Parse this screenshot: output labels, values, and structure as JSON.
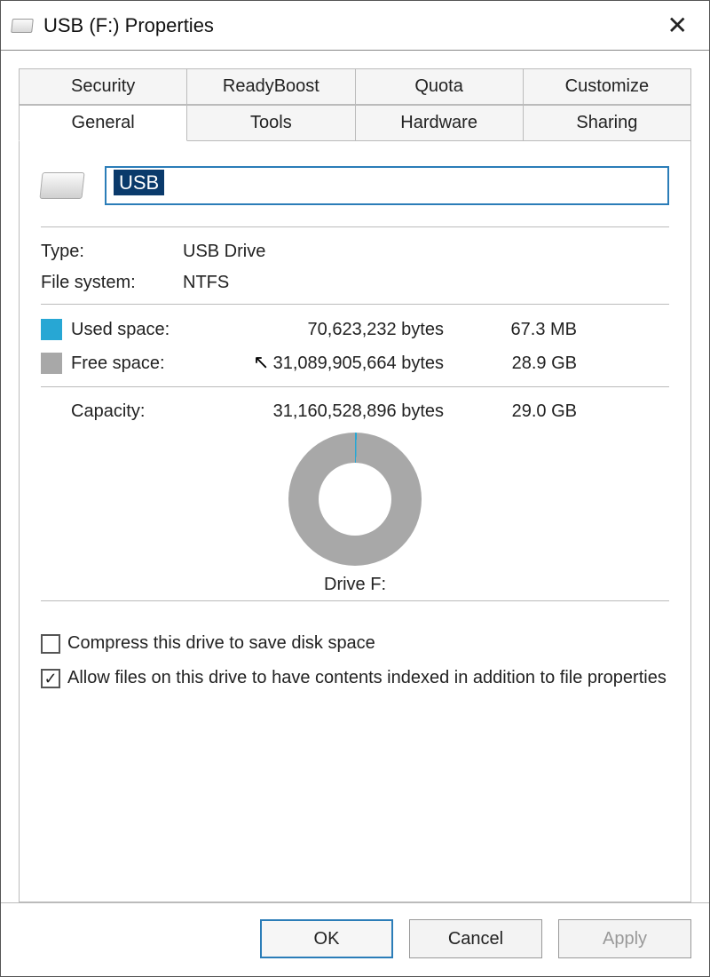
{
  "window": {
    "title": "USB (F:) Properties"
  },
  "tabs": {
    "row1": [
      "Security",
      "ReadyBoost",
      "Quota",
      "Customize"
    ],
    "row2": [
      "General",
      "Tools",
      "Hardware",
      "Sharing"
    ],
    "active": "General"
  },
  "drive": {
    "name": "USB",
    "type_label": "Type:",
    "type_value": "USB Drive",
    "fs_label": "File system:",
    "fs_value": "NTFS",
    "letter_label": "Drive F:"
  },
  "space": {
    "used_label": "Used space:",
    "used_bytes": "70,623,232 bytes",
    "used_human": "67.3 MB",
    "free_label": "Free space:",
    "free_bytes": "31,089,905,664 bytes",
    "free_human": "28.9 GB",
    "capacity_label": "Capacity:",
    "capacity_bytes": "31,160,528,896 bytes",
    "capacity_human": "29.0 GB"
  },
  "checks": {
    "compress_label": "Compress this drive to save disk space",
    "compress_checked": false,
    "index_label": "Allow files on this drive to have contents indexed in addition to file properties",
    "index_checked": true
  },
  "buttons": {
    "ok": "OK",
    "cancel": "Cancel",
    "apply": "Apply"
  },
  "colors": {
    "used": "#27a7d4",
    "free": "#a8a8a8",
    "accent": "#2b7db8"
  },
  "chart_data": {
    "type": "pie",
    "title": "Drive F:",
    "series": [
      {
        "name": "Used space",
        "value": 70623232,
        "human": "67.3 MB",
        "color": "#27a7d4"
      },
      {
        "name": "Free space",
        "value": 31089905664,
        "human": "28.9 GB",
        "color": "#a8a8a8"
      }
    ],
    "total": {
      "name": "Capacity",
      "value": 31160528896,
      "human": "29.0 GB"
    }
  }
}
